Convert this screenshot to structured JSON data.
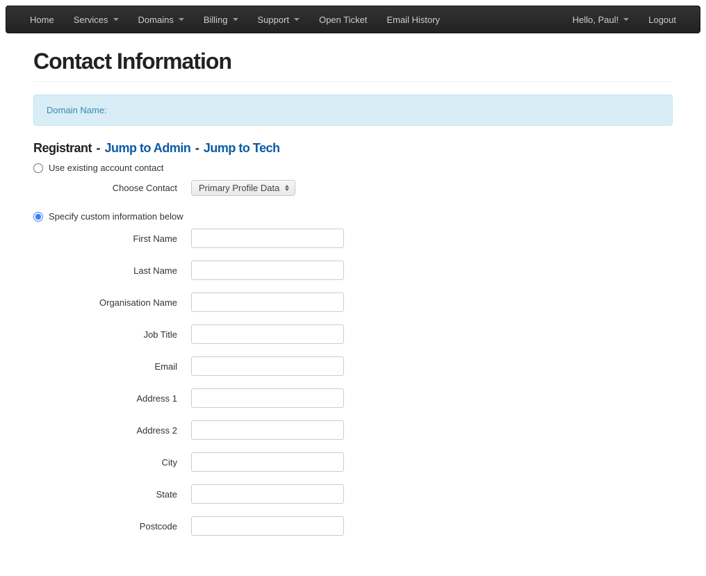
{
  "nav": {
    "home": "Home",
    "services": "Services",
    "domains": "Domains",
    "billing": "Billing",
    "support": "Support",
    "open_ticket": "Open Ticket",
    "email_history": "Email History",
    "greeting": "Hello, Paul!",
    "logout": "Logout"
  },
  "page": {
    "title": "Contact Information"
  },
  "alert": {
    "domain_label": "Domain Name:"
  },
  "section": {
    "registrant": "Registrant",
    "sep": "-",
    "jump_admin": "Jump to Admin",
    "jump_tech": "Jump to Tech"
  },
  "radio": {
    "use_existing": "Use existing account contact",
    "specify_custom": "Specify custom information below"
  },
  "choose_contact": {
    "label": "Choose Contact",
    "selected": "Primary Profile Data"
  },
  "fields": {
    "first_name": {
      "label": "First Name",
      "value": ""
    },
    "last_name": {
      "label": "Last Name",
      "value": ""
    },
    "organisation": {
      "label": "Organisation Name",
      "value": ""
    },
    "job_title": {
      "label": "Job Title",
      "value": ""
    },
    "email": {
      "label": "Email",
      "value": ""
    },
    "address1": {
      "label": "Address 1",
      "value": ""
    },
    "address2": {
      "label": "Address 2",
      "value": ""
    },
    "city": {
      "label": "City",
      "value": ""
    },
    "state": {
      "label": "State",
      "value": ""
    },
    "postcode": {
      "label": "Postcode",
      "value": ""
    }
  }
}
